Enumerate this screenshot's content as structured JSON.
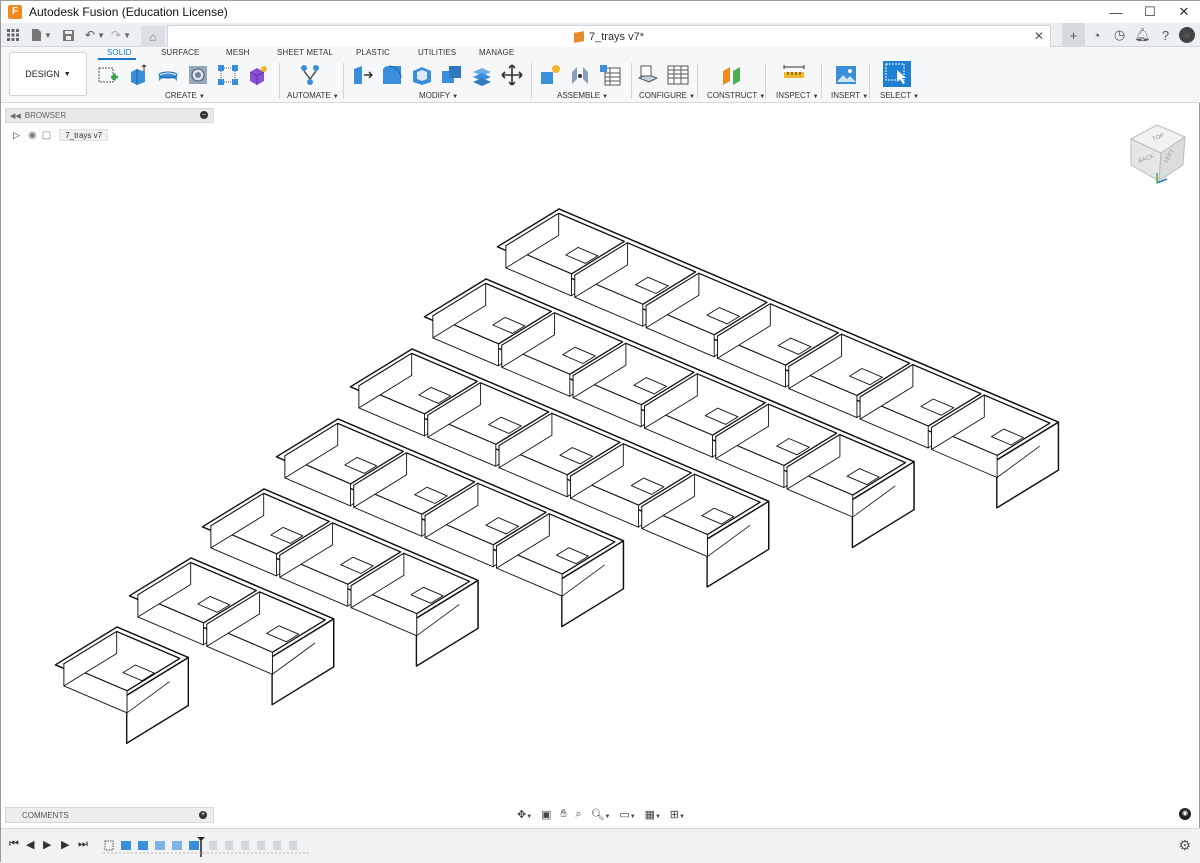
{
  "window": {
    "title": "Autodesk Fusion (Education License)",
    "logo_letter": "F",
    "controls": [
      "—",
      "☐",
      "✕"
    ]
  },
  "tabbar": {
    "document_title": "7_trays v7*",
    "close_icon": "✕"
  },
  "ribbon": {
    "workspace_button": "DESIGN",
    "tabs": [
      "SOLID",
      "SURFACE",
      "MESH",
      "SHEET METAL",
      "PLASTIC",
      "UTILITIES",
      "MANAGE"
    ],
    "active_tab": "SOLID",
    "groups": [
      "CREATE",
      "AUTOMATE",
      "MODIFY",
      "ASSEMBLE",
      "CONFIGURE",
      "CONSTRUCT",
      "INSPECT",
      "INSERT",
      "SELECT"
    ]
  },
  "browser": {
    "header": "BROWSER",
    "root_item": "7_trays v7"
  },
  "viewcube": {
    "faces": [
      "TOP",
      "BACK",
      "LEFT"
    ]
  },
  "comments": {
    "label": "COMMENTS"
  },
  "model": {
    "tray_compartment_counts": [
      1,
      2,
      3,
      4,
      5,
      6,
      7
    ]
  },
  "colors": {
    "accent": "#1a73c9",
    "select_blue": "#1f7fd0",
    "logo_orange": "#f08a1c"
  }
}
